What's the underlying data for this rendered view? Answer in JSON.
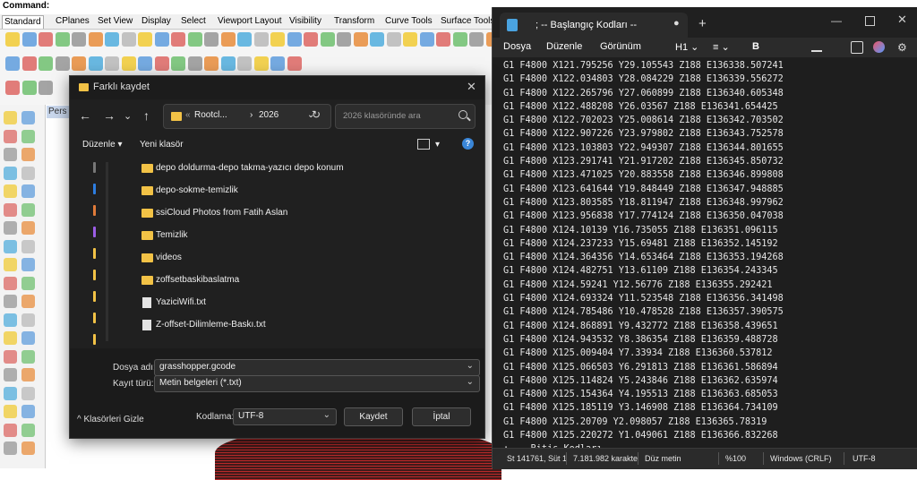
{
  "rhino": {
    "command_label": "Command:",
    "tabs": [
      "Standard",
      "CPlanes",
      "Set View",
      "Display",
      "Select",
      "Viewport Layout",
      "Visibility",
      "Transform",
      "Curve Tools",
      "Surface Tools"
    ],
    "viewport_label": "Pers"
  },
  "notepad": {
    "tab_title": "; -- Başlangıç Kodları --",
    "tab_close": "●",
    "new_tab": "+",
    "controls": {
      "minimize": "—",
      "close": "✕"
    },
    "menu": [
      "Dosya",
      "Düzenle",
      "Görünüm",
      "H1 ⌄",
      "≡ ⌄",
      "B"
    ],
    "lines": [
      "G1 F4800 X121.795256 Y29.105543 Z188 E136338.507241",
      "G1 F4800 X122.034803 Y28.084229 Z188 E136339.556272",
      "G1 F4800 X122.265796 Y27.060899 Z188 E136340.605348",
      "G1 F4800 X122.488208 Y26.03567 Z188 E136341.654425",
      "G1 F4800 X122.702023 Y25.008614 Z188 E136342.703502",
      "G1 F4800 X122.907226 Y23.979802 Z188 E136343.752578",
      "G1 F4800 X123.103803 Y22.949307 Z188 E136344.801655",
      "G1 F4800 X123.291741 Y21.917202 Z188 E136345.850732",
      "G1 F4800 X123.471025 Y20.883558 Z188 E136346.899808",
      "G1 F4800 X123.641644 Y19.848449 Z188 E136347.948885",
      "G1 F4800 X123.803585 Y18.811947 Z188 E136348.997962",
      "G1 F4800 X123.956838 Y17.774124 Z188 E136350.047038",
      "G1 F4800 X124.10139 Y16.735055 Z188 E136351.096115",
      "G1 F4800 X124.237233 Y15.69481 Z188 E136352.145192",
      "G1 F4800 X124.364356 Y14.653464 Z188 E136353.194268",
      "G1 F4800 X124.482751 Y13.61109 Z188 E136354.243345",
      "G1 F4800 X124.59241 Y12.56776 Z188 E136355.292421",
      "G1 F4800 X124.693324 Y11.523548 Z188 E136356.341498",
      "G1 F4800 X124.785486 Y10.478528 Z188 E136357.390575",
      "G1 F4800 X124.868891 Y9.432772 Z188 E136358.439651",
      "G1 F4800 X124.943532 Y8.386354 Z188 E136359.488728",
      "G1 F4800 X125.009404 Y7.33934 Z188 E136360.537812",
      "G1 F4800 X125.066503 Y6.291813 Z188 E136361.586894",
      "G1 F4800 X125.114824 Y5.243846 Z188 E136362.635974",
      "G1 F4800 X125.154364 Y4.195513 Z188 E136363.685053",
      "G1 F4800 X125.185119 Y3.146908 Z188 E136364.734109",
      "G1 F4800 X125.20709 Y2.098057 Z188 E136365.78319",
      "G1 F4800 X125.220272 Y1.049061 Z188 E136366.832268",
      "; -- Bitiş Kodları --",
      "G28",
      "; -- Bitiş Kodları --"
    ],
    "status": {
      "position": "St 141761, Süt 1",
      "chars": "7.181.982 karakte",
      "format": "Düz metin",
      "zoom": "%100",
      "eol": "Windows (CRLF)",
      "encoding": "UTF-8"
    }
  },
  "dialog": {
    "title": "Farklı kaydet",
    "close": "✕",
    "nav": {
      "back": "←",
      "forward": "→",
      "down": "⌄",
      "up": "↑"
    },
    "address": {
      "prefix": "«",
      "part1": "Rootcl...",
      "sep": "›",
      "part2": "2026",
      "chevron": "⌄",
      "refresh": "↻"
    },
    "search_placeholder": "2026 klasöründe ara",
    "organize": "Düzenle ▾",
    "new_folder": "Yeni klasör",
    "view_chevron": "▾",
    "help": "?",
    "files": [
      {
        "name": "depo doldurma-depo takma-yazıcı depo konum",
        "type": "folder"
      },
      {
        "name": "depo-sokme-temizlik",
        "type": "folder"
      },
      {
        "name": "ssiCloud Photos from Fatih Aslan",
        "type": "folder"
      },
      {
        "name": "Temizlik",
        "type": "folder"
      },
      {
        "name": "videos",
        "type": "folder"
      },
      {
        "name": "zoffsetbaskibaslatma",
        "type": "folder"
      },
      {
        "name": "YaziciWifi.txt",
        "type": "file"
      },
      {
        "name": "Z-offset-Dilimleme-Baskı.txt",
        "type": "file"
      }
    ],
    "filename_label": "Dosya adı:",
    "filename_value": "grasshopper.gcode",
    "filetype_label": "Kayıt türü:",
    "filetype_value": "Metin belgeleri (*.txt)",
    "hide_folders": "^  Klasörleri Gizle",
    "encoding_label": "Kodlama:",
    "encoding_value": "UTF-8",
    "save_button": "Kaydet",
    "cancel_button": "İptal",
    "chevron": "⌄"
  },
  "colors": {
    "accent": "#f2c246",
    "dark_bg": "#1f1f1f",
    "wire": "#b31212"
  }
}
